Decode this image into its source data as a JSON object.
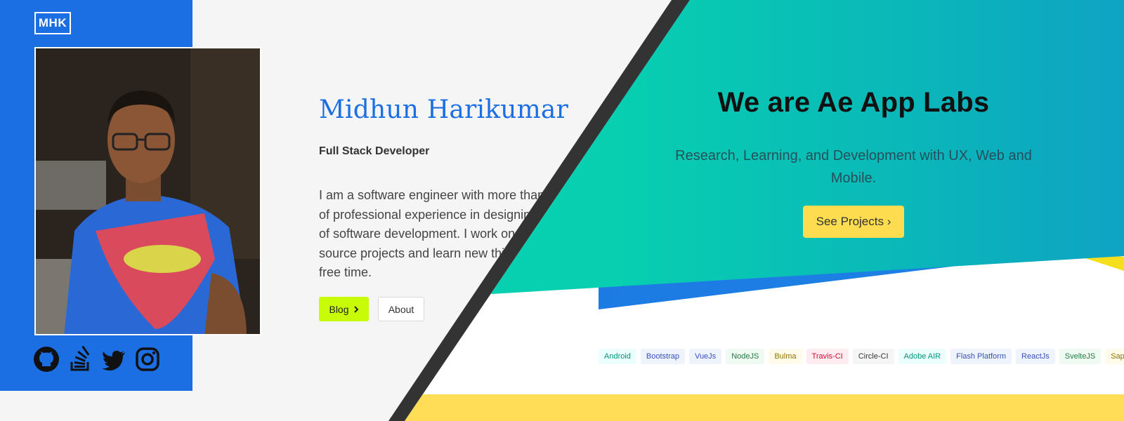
{
  "left": {
    "logo": "MHK",
    "name": "Midhun Harikumar",
    "role": "Full Stack Developer",
    "bio_lines": [
      "I am a software engineer with more than",
      "of professional experience in designing",
      "of software development. I work on open",
      "source projects and learn new things in",
      "free time."
    ],
    "buttons": {
      "blog": "Blog",
      "about": "About"
    },
    "social_icons": [
      "github-icon",
      "stack-overflow-icon",
      "twitter-icon",
      "instagram-icon"
    ],
    "colors": {
      "primary_blue": "#1b6fe3",
      "blog_green": "#c8fb07"
    }
  },
  "right": {
    "title": "We are Ae App Labs",
    "subtitle": "Research, Learning, and Development with UX, Web and Mobile.",
    "cta": "See Projects ›",
    "tags": [
      {
        "label": "Android",
        "bg": "#ebfffc",
        "color": "#00947e"
      },
      {
        "label": "Bootstrap",
        "bg": "#eef3fc",
        "color": "#3850b7"
      },
      {
        "label": "VueJs",
        "bg": "#eef3fc",
        "color": "#3850b7"
      },
      {
        "label": "NodeJS",
        "bg": "#effaf3",
        "color": "#257942"
      },
      {
        "label": "Bulma",
        "bg": "#fffbeb",
        "color": "#947600"
      },
      {
        "label": "Travis-CI",
        "bg": "#feecf0",
        "color": "#cc0f35"
      },
      {
        "label": "Circle-CI",
        "bg": "#f5f5f5",
        "color": "#363636"
      },
      {
        "label": "Adobe AIR",
        "bg": "#ebfffc",
        "color": "#00947e"
      },
      {
        "label": "Flash Platform",
        "bg": "#eef3fc",
        "color": "#3850b7"
      },
      {
        "label": "ReactJs",
        "bg": "#eef3fc",
        "color": "#3850b7"
      },
      {
        "label": "SvelteJS",
        "bg": "#effaf3",
        "color": "#257942"
      },
      {
        "label": "SapperJS",
        "bg": "#fffbeb",
        "color": "#947600"
      }
    ],
    "colors": {
      "teal": "#05d3b2",
      "cta_yellow": "#fedc4f"
    }
  }
}
